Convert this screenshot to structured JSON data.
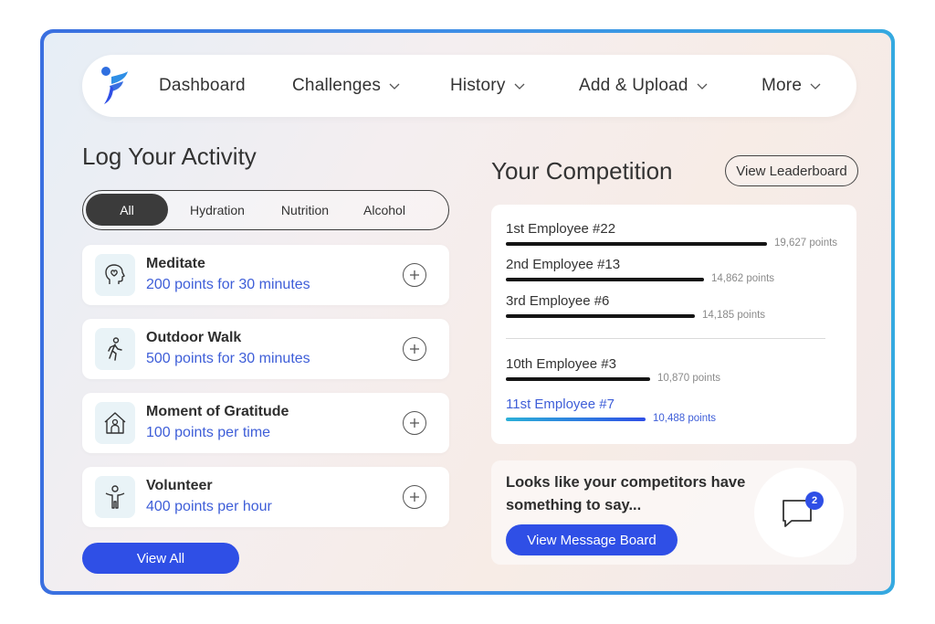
{
  "nav": {
    "items": [
      {
        "label": "Dashboard",
        "has_dropdown": false
      },
      {
        "label": "Challenges",
        "has_dropdown": true
      },
      {
        "label": "History",
        "has_dropdown": true
      },
      {
        "label": "Add & Upload",
        "has_dropdown": true
      },
      {
        "label": "More",
        "has_dropdown": true
      }
    ]
  },
  "log": {
    "title": "Log Your Activity",
    "filters": [
      "All",
      "Hydration",
      "Nutrition",
      "Alcohol"
    ],
    "active_filter": "All",
    "activities": [
      {
        "name": "Meditate",
        "points": "200 points for 30 minutes",
        "icon": "head-heart-icon"
      },
      {
        "name": "Outdoor Walk",
        "points": "500 points for 30 minutes",
        "icon": "walking-person-icon"
      },
      {
        "name": "Moment of Gratitude",
        "points": "100 points per time",
        "icon": "house-person-icon"
      },
      {
        "name": "Volunteer",
        "points": "400 points per hour",
        "icon": "person-arms-up-icon"
      }
    ],
    "view_all_label": "View All"
  },
  "competition": {
    "title": "Your Competition",
    "leaderboard_label": "View Leaderboard",
    "entries": [
      {
        "name": "1st Employee #22",
        "points": "19,627 points",
        "value": 19627,
        "is_user": false
      },
      {
        "name": "2nd Employee #13",
        "points": "14,862 points",
        "value": 14862,
        "is_user": false
      },
      {
        "name": "3rd Employee #6",
        "points": "14,185 points",
        "value": 14185,
        "is_user": false
      },
      {
        "name": "10th Employee #3",
        "points": "10,870 points",
        "value": 10870,
        "is_user": false
      },
      {
        "name": "11st Employee #7",
        "points": "10,488 points",
        "value": 10488,
        "is_user": true
      }
    ]
  },
  "messages": {
    "text": "Looks like your competitors have something to say...",
    "button_label": "View Message Board",
    "badge_count": "2"
  },
  "colors": {
    "accent": "#2f4fe6",
    "points_text": "#3e5ed8",
    "frame_gradient_start": "#3a6fe0",
    "frame_gradient_end": "#35a9e0"
  }
}
